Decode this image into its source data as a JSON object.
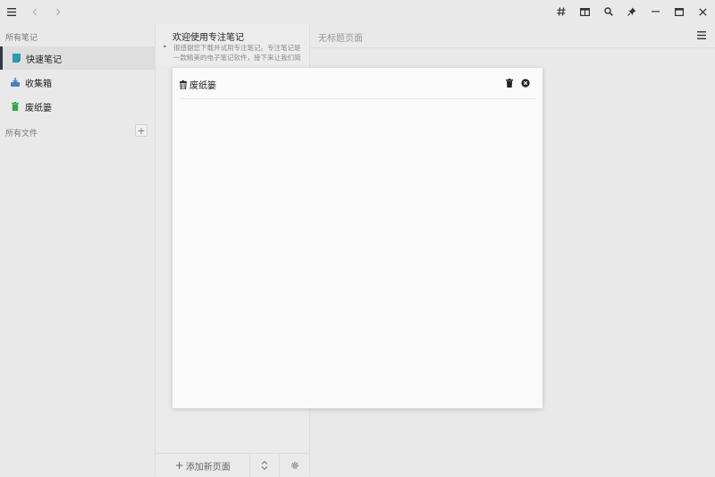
{
  "sidebar": {
    "all_notes_label": "所有笔记",
    "items": [
      {
        "label": "快速笔记",
        "icon": "note-icon",
        "color": "#2a9bb0"
      },
      {
        "label": "收集箱",
        "icon": "inbox-icon",
        "color": "#4a7fc1"
      },
      {
        "label": "废纸篓",
        "icon": "trash-icon",
        "color": "#2fa84f"
      }
    ],
    "all_files_label": "所有文件",
    "add_label": "+"
  },
  "note_list": {
    "notes": [
      {
        "title": "欢迎使用专注笔记",
        "snippet": "很感谢您下载并试用专注笔记。专注笔记是一款精美的电子笔记软件，接下来让我们简单..."
      }
    ],
    "add_page_label": "添加新页面"
  },
  "editor": {
    "title": "无标题页面"
  },
  "trash_dialog": {
    "title": "废纸篓"
  }
}
